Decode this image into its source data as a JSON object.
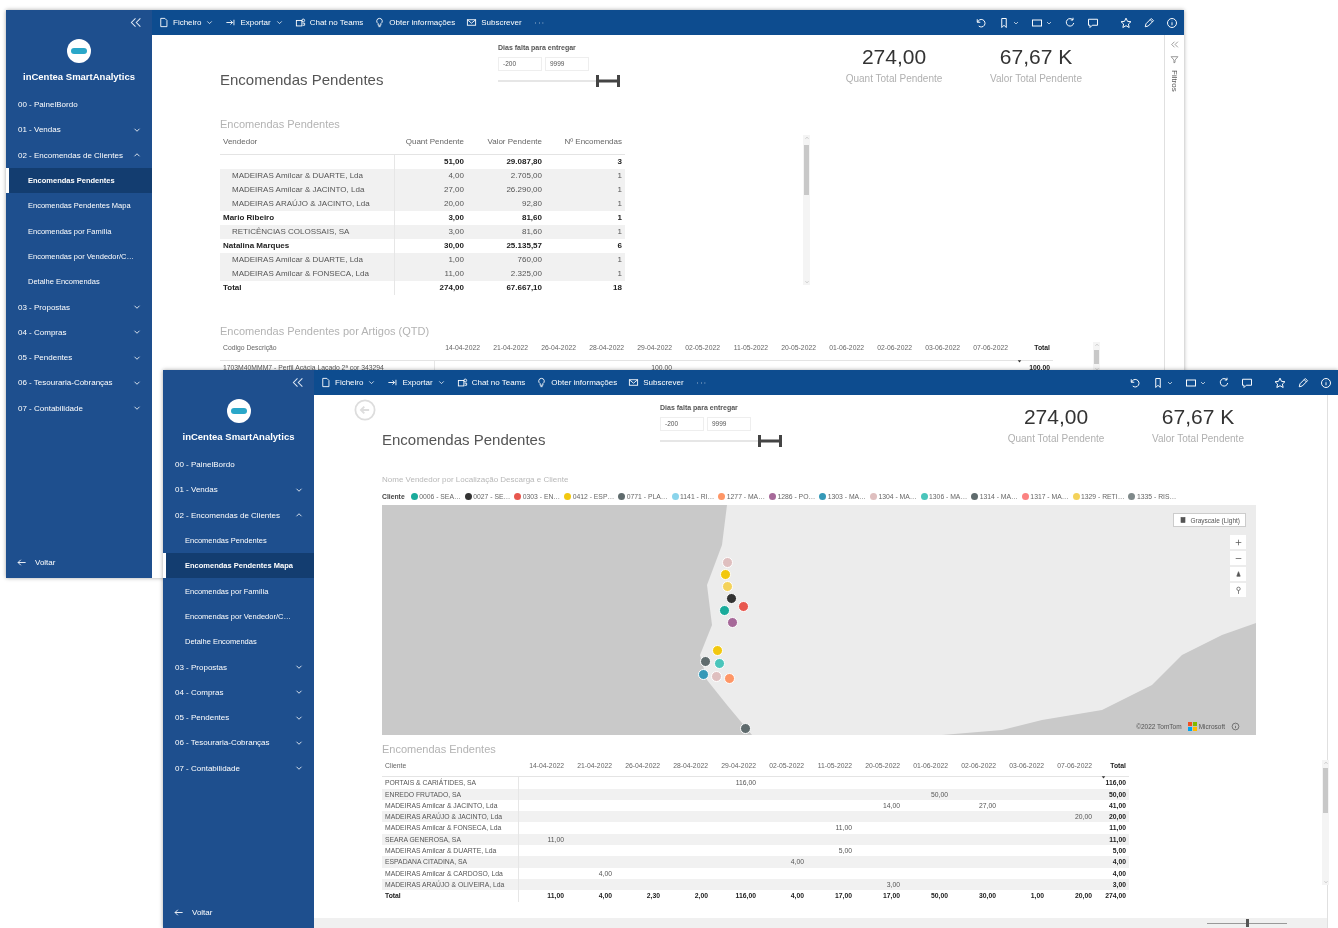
{
  "windows": [
    {
      "nav": {
        "brand": "inCentea SmartAnalytics",
        "items": [
          {
            "label": "00 - PainelBordo",
            "kind": "page",
            "selected": false
          },
          {
            "label": "01 - Vendas",
            "kind": "section",
            "expanded": false
          },
          {
            "label": "02 - Encomendas de Clientes",
            "kind": "section",
            "expanded": true,
            "children": [
              {
                "label": "Encomendas Pendentes",
                "kind": "page",
                "selected": true
              },
              {
                "label": "Encomendas Pendentes Mapa",
                "kind": "page",
                "selected": false
              },
              {
                "label": "Encomendas por Família",
                "kind": "page",
                "selected": false
              },
              {
                "label": "Encomendas por Vendedor/C…",
                "kind": "page",
                "selected": false
              },
              {
                "label": "Detalhe Encomendas",
                "kind": "page",
                "selected": false
              }
            ]
          },
          {
            "label": "03 - Propostas",
            "kind": "section",
            "expanded": false
          },
          {
            "label": "04 - Compras",
            "kind": "section",
            "expanded": false
          },
          {
            "label": "05 - Pendentes",
            "kind": "section",
            "expanded": false
          },
          {
            "label": "06 - Tesouraria-Cobranças",
            "kind": "section",
            "expanded": false
          },
          {
            "label": "07 - Contabilidade",
            "kind": "section",
            "expanded": false
          }
        ],
        "back": "Voltar"
      },
      "toolbar": {
        "menu": [
          {
            "label": "Ficheiro",
            "dropdown": true
          },
          {
            "label": "Exportar",
            "dropdown": true
          },
          {
            "label": "Chat no Teams",
            "dropdown": false
          },
          {
            "label": "Obter informações",
            "dropdown": false
          },
          {
            "label": "Subscrever",
            "dropdown": false
          }
        ]
      },
      "page": {
        "title": "Encomendas Pendentes",
        "back_button": false,
        "slicer": {
          "label": "Dias falta para entregar",
          "min": "-200",
          "max": "9999",
          "level": 1
        },
        "cards": [
          {
            "value": "274,00",
            "label": "Quant Total Pendente"
          },
          {
            "value": "67,67 K",
            "label": "Valor Total Pendente"
          }
        ],
        "visuals": [
          {
            "kind": "table",
            "title": "Encomendas Pendentes",
            "columns": [
              "Vendedor",
              "Quant Pendente",
              "Valor Pendente",
              "Nº Encomendas"
            ],
            "rows": [
              {
                "kind": "group",
                "values": [
                  "51,00",
                  "29.087,80",
                  "3"
                ]
              },
              {
                "kind": "detail",
                "name": "MADEIRAS Amílcar & DUARTE, Lda",
                "values": [
                  "4,00",
                  "2.705,00",
                  "1"
                ]
              },
              {
                "kind": "detail",
                "name": "MADEIRAS Amílcar & JACINTO, Lda",
                "values": [
                  "27,00",
                  "26.290,00",
                  "1"
                ]
              },
              {
                "kind": "detail",
                "name": "MADEIRAS ARAÚJO & JACINTO, Lda",
                "values": [
                  "20,00",
                  "92,80",
                  "1"
                ]
              },
              {
                "kind": "group",
                "name": "Mario Ribeiro",
                "values": [
                  "3,00",
                  "81,60",
                  "1"
                ]
              },
              {
                "kind": "detail",
                "name": "RETICÊNCIAS COLOSSAIS, SA",
                "values": [
                  "3,00",
                  "81,60",
                  "1"
                ]
              },
              {
                "kind": "group",
                "name": "Natalina Marques",
                "values": [
                  "30,00",
                  "25.135,57",
                  "6"
                ]
              },
              {
                "kind": "detail",
                "name": "MADEIRAS Amílcar & DUARTE, Lda",
                "values": [
                  "1,00",
                  "760,00",
                  "1"
                ]
              },
              {
                "kind": "detail",
                "name": "MADEIRAS Amílcar & FONSECA, Lda",
                "values": [
                  "11,00",
                  "2.325,00",
                  "1"
                ]
              },
              {
                "kind": "total",
                "name": "Total",
                "values": [
                  "274,00",
                  "67.667,10",
                  "18"
                ]
              }
            ]
          },
          {
            "kind": "matrix",
            "title": "Encomendas Pendentes por Artigos (QTD)",
            "sorted": true,
            "columns": [
              "Codigo Descrição",
              "14-04-2022",
              "21-04-2022",
              "26-04-2022",
              "28-04-2022",
              "29-04-2022",
              "02-05-2022",
              "11-05-2022",
              "20-05-2022",
              "01-06-2022",
              "02-06-2022",
              "03-06-2022",
              "07-06-2022",
              "Total"
            ],
            "rows": [
              {
                "kind": "detail",
                "name": "1703M40MMM7 - Perfil Acácia Lacado 2ª cor 343294",
                "values": [
                  {
                    "kind": "blank"
                  },
                  {
                    "kind": "blank"
                  },
                  {
                    "kind": "blank"
                  },
                  {
                    "kind": "blank"
                  },
                  {
                    "kind": "value",
                    "text": "100,00"
                  },
                  {
                    "kind": "blank"
                  },
                  {
                    "kind": "blank"
                  },
                  {
                    "kind": "blank"
                  },
                  {
                    "kind": "blank"
                  },
                  {
                    "kind": "blank"
                  },
                  {
                    "kind": "blank"
                  },
                  {
                    "kind": "blank"
                  },
                  {
                    "kind": "value",
                    "text": "100,00"
                  }
                ]
              }
            ]
          }
        ]
      },
      "filter_pane": {
        "label": "Filtros"
      }
    },
    {
      "nav": {
        "brand": "inCentea SmartAnalytics",
        "items": [
          {
            "label": "00 - PainelBordo",
            "kind": "page",
            "selected": false
          },
          {
            "label": "01 - Vendas",
            "kind": "section",
            "expanded": false
          },
          {
            "label": "02 - Encomendas de Clientes",
            "kind": "section",
            "expanded": true,
            "children": [
              {
                "label": "Encomendas Pendentes",
                "kind": "page",
                "selected": false
              },
              {
                "label": "Encomendas Pendentes Mapa",
                "kind": "page",
                "selected": true
              },
              {
                "label": "Encomendas por Família",
                "kind": "page",
                "selected": false
              },
              {
                "label": "Encomendas por Vendedor/C…",
                "kind": "page",
                "selected": false
              },
              {
                "label": "Detalhe Encomendas",
                "kind": "page",
                "selected": false
              }
            ]
          },
          {
            "label": "03 - Propostas",
            "kind": "section",
            "expanded": false
          },
          {
            "label": "04 - Compras",
            "kind": "section",
            "expanded": false
          },
          {
            "label": "05 - Pendentes",
            "kind": "section",
            "expanded": false
          },
          {
            "label": "06 - Tesouraria-Cobranças",
            "kind": "section",
            "expanded": false
          },
          {
            "label": "07 - Contabilidade",
            "kind": "section",
            "expanded": false
          }
        ],
        "back": "Voltar"
      },
      "toolbar": {
        "menu": [
          {
            "label": "Ficheiro",
            "dropdown": true
          },
          {
            "label": "Exportar",
            "dropdown": true
          },
          {
            "label": "Chat no Teams",
            "dropdown": false
          },
          {
            "label": "Obter informações",
            "dropdown": false
          },
          {
            "label": "Subscrever",
            "dropdown": false
          }
        ]
      },
      "page": {
        "title": "Encomendas Pendentes",
        "back_button": true,
        "slicer": {
          "label": "Dias falta para entregar",
          "min": "-200",
          "max": "9999",
          "level": 1
        },
        "cards": [
          {
            "value": "274,00",
            "label": "Quant Total Pendente"
          },
          {
            "value": "67,67 K",
            "label": "Valor Total Pendente"
          }
        ],
        "visuals": [
          {
            "kind": "map",
            "title": "Nome Vendedor por Localização Descarga e Cliente",
            "legend": {
              "label": "Cliente",
              "entries": [
                {
                  "label": "0006 - SEA…",
                  "color": "#1aab9b"
                },
                {
                  "label": "0027 - SE…",
                  "color": "#333333"
                },
                {
                  "label": "0303 - EN…",
                  "color": "#e8574e"
                },
                {
                  "label": "0412 - ESP…",
                  "color": "#f2c80f"
                },
                {
                  "label": "0771 - PLA…",
                  "color": "#5f6b6d"
                },
                {
                  "label": "1141 - RI…",
                  "color": "#8ad4eb"
                },
                {
                  "label": "1277 - MA…",
                  "color": "#fe9666"
                },
                {
                  "label": "1286 - PO…",
                  "color": "#a66999"
                },
                {
                  "label": "1303 - MA…",
                  "color": "#3599b8"
                },
                {
                  "label": "1304 - MA…",
                  "color": "#dfbfbf"
                },
                {
                  "label": "1306 - MA…",
                  "color": "#4ac5bb"
                },
                {
                  "label": "1314 - MA…",
                  "color": "#5f6b6d"
                },
                {
                  "label": "1317 - MA…",
                  "color": "#fb8281"
                },
                {
                  "label": "1329 - RETI…",
                  "color": "#f4d25a"
                },
                {
                  "label": "1335 - RIS…",
                  "color": "#7f898a"
                }
              ]
            },
            "style_button": "Grayscale (Light)",
            "attribution": "©2022 TomTom",
            "brand": "Microsoft"
          },
          {
            "kind": "matrix",
            "title": "Encomendas Endentes",
            "sorted": true,
            "columns": [
              "Cliente",
              "14-04-2022",
              "21-04-2022",
              "26-04-2022",
              "28-04-2022",
              "29-04-2022",
              "02-05-2022",
              "11-05-2022",
              "20-05-2022",
              "01-06-2022",
              "02-06-2022",
              "03-06-2022",
              "07-06-2022",
              "Total"
            ],
            "rows": [
              {
                "kind": "detail",
                "name": "PORTAIS & CARIÁTIDES, SA",
                "values": [
                  {
                    "kind": "blank"
                  },
                  {
                    "kind": "blank"
                  },
                  {
                    "kind": "blank"
                  },
                  {
                    "kind": "blank"
                  },
                  {
                    "kind": "value",
                    "text": "116,00"
                  },
                  {
                    "kind": "blank"
                  },
                  {
                    "kind": "blank"
                  },
                  {
                    "kind": "blank"
                  },
                  {
                    "kind": "blank"
                  },
                  {
                    "kind": "blank"
                  },
                  {
                    "kind": "blank"
                  },
                  {
                    "kind": "blank"
                  },
                  {
                    "kind": "value",
                    "text": "116,00"
                  }
                ]
              },
              {
                "kind": "detail",
                "name": "ENREDO FRUTADO, SA",
                "values": [
                  {
                    "kind": "blank"
                  },
                  {
                    "kind": "blank"
                  },
                  {
                    "kind": "blank"
                  },
                  {
                    "kind": "blank"
                  },
                  {
                    "kind": "blank"
                  },
                  {
                    "kind": "blank"
                  },
                  {
                    "kind": "blank"
                  },
                  {
                    "kind": "blank"
                  },
                  {
                    "kind": "value",
                    "text": "50,00"
                  },
                  {
                    "kind": "blank"
                  },
                  {
                    "kind": "blank"
                  },
                  {
                    "kind": "blank"
                  },
                  {
                    "kind": "value",
                    "text": "50,00"
                  }
                ]
              },
              {
                "kind": "detail",
                "name": "MADEIRAS Amílcar & JACINTO, Lda",
                "values": [
                  {
                    "kind": "blank"
                  },
                  {
                    "kind": "blank"
                  },
                  {
                    "kind": "blank"
                  },
                  {
                    "kind": "blank"
                  },
                  {
                    "kind": "blank"
                  },
                  {
                    "kind": "blank"
                  },
                  {
                    "kind": "blank"
                  },
                  {
                    "kind": "value",
                    "text": "14,00"
                  },
                  {
                    "kind": "blank"
                  },
                  {
                    "kind": "value",
                    "text": "27,00"
                  },
                  {
                    "kind": "blank"
                  },
                  {
                    "kind": "blank"
                  },
                  {
                    "kind": "value",
                    "text": "41,00"
                  }
                ]
              },
              {
                "kind": "detail",
                "name": "MADEIRAS ARAÚJO & JACINTO, Lda",
                "values": [
                  {
                    "kind": "blank"
                  },
                  {
                    "kind": "blank"
                  },
                  {
                    "kind": "blank"
                  },
                  {
                    "kind": "blank"
                  },
                  {
                    "kind": "blank"
                  },
                  {
                    "kind": "blank"
                  },
                  {
                    "kind": "blank"
                  },
                  {
                    "kind": "blank"
                  },
                  {
                    "kind": "blank"
                  },
                  {
                    "kind": "blank"
                  },
                  {
                    "kind": "blank"
                  },
                  {
                    "kind": "value",
                    "text": "20,00"
                  },
                  {
                    "kind": "value",
                    "text": "20,00"
                  }
                ]
              },
              {
                "kind": "detail",
                "name": "MADEIRAS Amílcar & FONSECA, Lda",
                "values": [
                  {
                    "kind": "blank"
                  },
                  {
                    "kind": "blank"
                  },
                  {
                    "kind": "blank"
                  },
                  {
                    "kind": "blank"
                  },
                  {
                    "kind": "blank"
                  },
                  {
                    "kind": "blank"
                  },
                  {
                    "kind": "value",
                    "text": "11,00"
                  },
                  {
                    "kind": "blank"
                  },
                  {
                    "kind": "blank"
                  },
                  {
                    "kind": "blank"
                  },
                  {
                    "kind": "blank"
                  },
                  {
                    "kind": "blank"
                  },
                  {
                    "kind": "value",
                    "text": "11,00"
                  }
                ]
              },
              {
                "kind": "detail",
                "name": "SEARA GENEROSA, SA",
                "values": [
                  {
                    "kind": "value",
                    "text": "11,00"
                  },
                  {
                    "kind": "blank"
                  },
                  {
                    "kind": "blank"
                  },
                  {
                    "kind": "blank"
                  },
                  {
                    "kind": "blank"
                  },
                  {
                    "kind": "blank"
                  },
                  {
                    "kind": "blank"
                  },
                  {
                    "kind": "blank"
                  },
                  {
                    "kind": "blank"
                  },
                  {
                    "kind": "blank"
                  },
                  {
                    "kind": "blank"
                  },
                  {
                    "kind": "blank"
                  },
                  {
                    "kind": "value",
                    "text": "11,00"
                  }
                ]
              },
              {
                "kind": "detail",
                "name": "MADEIRAS Amílcar & DUARTE, Lda",
                "values": [
                  {
                    "kind": "blank"
                  },
                  {
                    "kind": "blank"
                  },
                  {
                    "kind": "blank"
                  },
                  {
                    "kind": "blank"
                  },
                  {
                    "kind": "blank"
                  },
                  {
                    "kind": "blank"
                  },
                  {
                    "kind": "value",
                    "text": "5,00"
                  },
                  {
                    "kind": "blank"
                  },
                  {
                    "kind": "blank"
                  },
                  {
                    "kind": "blank"
                  },
                  {
                    "kind": "blank"
                  },
                  {
                    "kind": "blank"
                  },
                  {
                    "kind": "value",
                    "text": "5,00"
                  }
                ]
              },
              {
                "kind": "detail",
                "name": "ESPADANA CITADINA, SA",
                "values": [
                  {
                    "kind": "blank"
                  },
                  {
                    "kind": "blank"
                  },
                  {
                    "kind": "blank"
                  },
                  {
                    "kind": "blank"
                  },
                  {
                    "kind": "blank"
                  },
                  {
                    "kind": "value",
                    "text": "4,00"
                  },
                  {
                    "kind": "blank"
                  },
                  {
                    "kind": "blank"
                  },
                  {
                    "kind": "blank"
                  },
                  {
                    "kind": "blank"
                  },
                  {
                    "kind": "blank"
                  },
                  {
                    "kind": "blank"
                  },
                  {
                    "kind": "value",
                    "text": "4,00"
                  }
                ]
              },
              {
                "kind": "detail",
                "name": "MADEIRAS Amílcar & CARDOSO, Lda",
                "values": [
                  {
                    "kind": "blank"
                  },
                  {
                    "kind": "value",
                    "text": "4,00"
                  },
                  {
                    "kind": "blank"
                  },
                  {
                    "kind": "blank"
                  },
                  {
                    "kind": "blank"
                  },
                  {
                    "kind": "blank"
                  },
                  {
                    "kind": "blank"
                  },
                  {
                    "kind": "blank"
                  },
                  {
                    "kind": "blank"
                  },
                  {
                    "kind": "blank"
                  },
                  {
                    "kind": "blank"
                  },
                  {
                    "kind": "blank"
                  },
                  {
                    "kind": "value",
                    "text": "4,00"
                  }
                ]
              },
              {
                "kind": "detail",
                "name": "MADEIRAS ARAÚJO & OLIVEIRA, Lda",
                "values": [
                  {
                    "kind": "blank"
                  },
                  {
                    "kind": "blank"
                  },
                  {
                    "kind": "blank"
                  },
                  {
                    "kind": "blank"
                  },
                  {
                    "kind": "blank"
                  },
                  {
                    "kind": "blank"
                  },
                  {
                    "kind": "blank"
                  },
                  {
                    "kind": "value",
                    "text": "3,00"
                  },
                  {
                    "kind": "blank"
                  },
                  {
                    "kind": "blank"
                  },
                  {
                    "kind": "blank"
                  },
                  {
                    "kind": "blank"
                  },
                  {
                    "kind": "value",
                    "text": "3,00"
                  }
                ]
              },
              {
                "kind": "total",
                "name": "Total",
                "values": [
                  "11,00",
                  "4,00",
                  "2,30",
                  "2,00",
                  "116,00",
                  "4,00",
                  "17,00",
                  "17,00",
                  "50,00",
                  "30,00",
                  "1,00",
                  "20,00",
                  "274,00"
                ]
              }
            ]
          }
        ]
      },
      "status_bar": {
        "zoom": {
          "level": 0.5
        }
      }
    }
  ]
}
